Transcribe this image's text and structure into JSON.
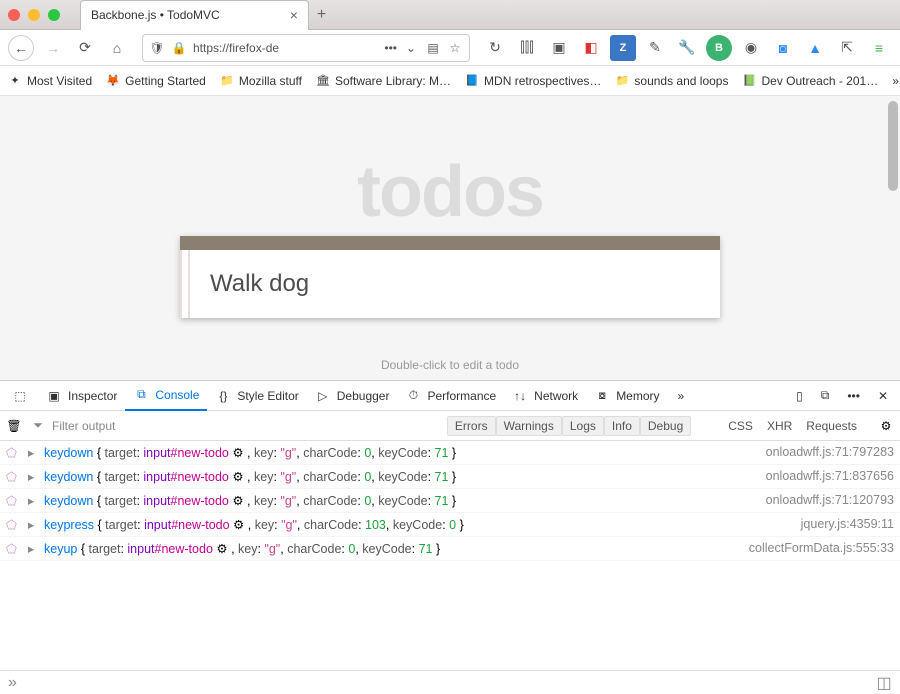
{
  "browser": {
    "tab_title": "Backbone.js • TodoMVC",
    "url_display": "https://firefox-de",
    "bookmarks": [
      {
        "icon": "✦",
        "label": "Most Visited"
      },
      {
        "icon": "🦊",
        "label": "Getting Started"
      },
      {
        "icon": "📁",
        "label": "Mozilla stuff"
      },
      {
        "icon": "🏛",
        "label": "Software Library: M…"
      },
      {
        "icon": "📘",
        "label": "MDN retrospectives…"
      },
      {
        "icon": "📁",
        "label": "sounds and loops"
      },
      {
        "icon": "📗",
        "label": "Dev Outreach - 201…"
      }
    ]
  },
  "app": {
    "title": "todos",
    "input_value": "Walk dog",
    "hint": "Double-click to edit a todo"
  },
  "devtools": {
    "tabs": [
      "Inspector",
      "Console",
      "Style Editor",
      "Debugger",
      "Performance",
      "Network",
      "Memory"
    ],
    "active_tab": "Console",
    "filter_placeholder": "Filter output",
    "filter_tags_left": [
      "Errors",
      "Warnings",
      "Logs",
      "Info",
      "Debug"
    ],
    "filter_tags_right": [
      "CSS",
      "XHR",
      "Requests"
    ],
    "rows": [
      {
        "event": "keydown",
        "element": "input",
        "id": "#new-todo",
        "key": "g",
        "charCode": 0,
        "keyCode": 71,
        "src": "onloadwff.js:71:797283"
      },
      {
        "event": "keydown",
        "element": "input",
        "id": "#new-todo",
        "key": "g",
        "charCode": 0,
        "keyCode": 71,
        "src": "onloadwff.js:71:837656"
      },
      {
        "event": "keydown",
        "element": "input",
        "id": "#new-todo",
        "key": "g",
        "charCode": 0,
        "keyCode": 71,
        "src": "onloadwff.js:71:120793"
      },
      {
        "event": "keypress",
        "element": "input",
        "id": "#new-todo",
        "key": "g",
        "charCode": 103,
        "keyCode": 0,
        "src": "jquery.js:4359:11"
      },
      {
        "event": "keyup",
        "element": "input",
        "id": "#new-todo",
        "key": "g",
        "charCode": 0,
        "keyCode": 71,
        "src": "collectFormData.js:555:33"
      }
    ]
  }
}
